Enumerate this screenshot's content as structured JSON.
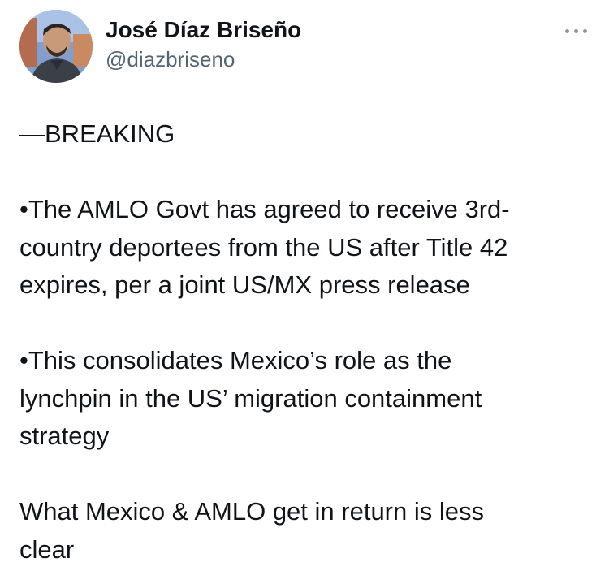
{
  "author": {
    "display_name": "José Díaz Briseño",
    "handle": "@diazbriseno",
    "avatar_icon": "user-avatar-photo"
  },
  "menu": {
    "icon": "more-options-icon"
  },
  "tweet": {
    "paragraphs": [
      "—BREAKING",
      "•The AMLO Govt has agreed to receive 3rd-\ncountry deportees from the US after Title 42\nexpires, per a joint US/MX press release",
      "•This consolidates Mexico’s role as the\nlynchpin in the US’ migration containment\nstrategy",
      "What Mexico & AMLO get in return is less\nclear"
    ]
  },
  "colors": {
    "text": "#0f1419",
    "secondary": "#536471",
    "background": "#ffffff"
  }
}
